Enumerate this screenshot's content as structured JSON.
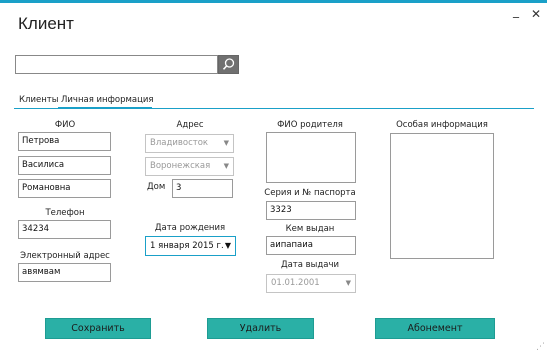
{
  "window": {
    "title": "Клиент",
    "minimize_glyph": "_",
    "close_glyph": "✕",
    "accent_color": "#1aa0c8"
  },
  "search": {
    "value": "",
    "icon": "search-icon"
  },
  "tabs": [
    {
      "label": "Клиенты",
      "active": false
    },
    {
      "label": "Личная информация",
      "active": true
    }
  ],
  "personal": {
    "fio_label": "ФИО",
    "last_name": "Петрова",
    "first_name": "Василиса",
    "patronymic": "Романовна",
    "phone_label": "Телефон",
    "phone": "34234",
    "email_label": "Электронный адрес",
    "email": "авямвам"
  },
  "address": {
    "label": "Адрес",
    "city": "Владивосток",
    "street": "Воронежская",
    "house_label": "Дом",
    "house": "3",
    "birth_label": "Дата рождения",
    "birth_date": "1 января 2015 г."
  },
  "parent": {
    "fio_label": "ФИО родителя",
    "fio_value": "",
    "passport_label": "Серия и № паспорта",
    "passport": "3323",
    "issued_by_label": "Кем выдан",
    "issued_by": "аипапаиа",
    "issue_date_label": "Дата выдачи",
    "issue_date": "01.01.2001"
  },
  "special": {
    "label": "Особая информация",
    "value": ""
  },
  "buttons": {
    "save": "Сохранить",
    "delete": "Удалить",
    "subscription": "Абонемент",
    "color": "#2ab0a6"
  }
}
